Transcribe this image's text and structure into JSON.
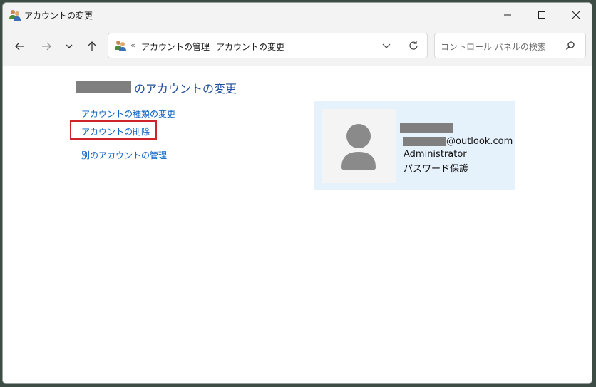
{
  "window": {
    "title": "アカウントの変更",
    "controls": {
      "minimize": "minimize",
      "maximize": "maximize",
      "close": "close"
    }
  },
  "nav": {
    "breadcrumb_sep": "«",
    "breadcrumbs": [
      "アカウントの管理",
      "アカウントの変更"
    ],
    "crumb_arrow": "›",
    "search_placeholder": "コントロール パネルの検索"
  },
  "main": {
    "heading_suffix": "のアカウントの変更",
    "links": [
      {
        "label": "アカウントの種類の変更"
      },
      {
        "label": "アカウントの削除",
        "highlighted": true
      },
      {
        "label": "別のアカウントの管理"
      }
    ]
  },
  "user_card": {
    "email_suffix": "@outlook.com",
    "role": "Administrator",
    "password_status": "パスワード保護"
  },
  "colors": {
    "link": "#0b62c4",
    "heading": "#1f4e9c",
    "card_bg": "#e5f1fb",
    "highlight_border": "#d0232a"
  }
}
